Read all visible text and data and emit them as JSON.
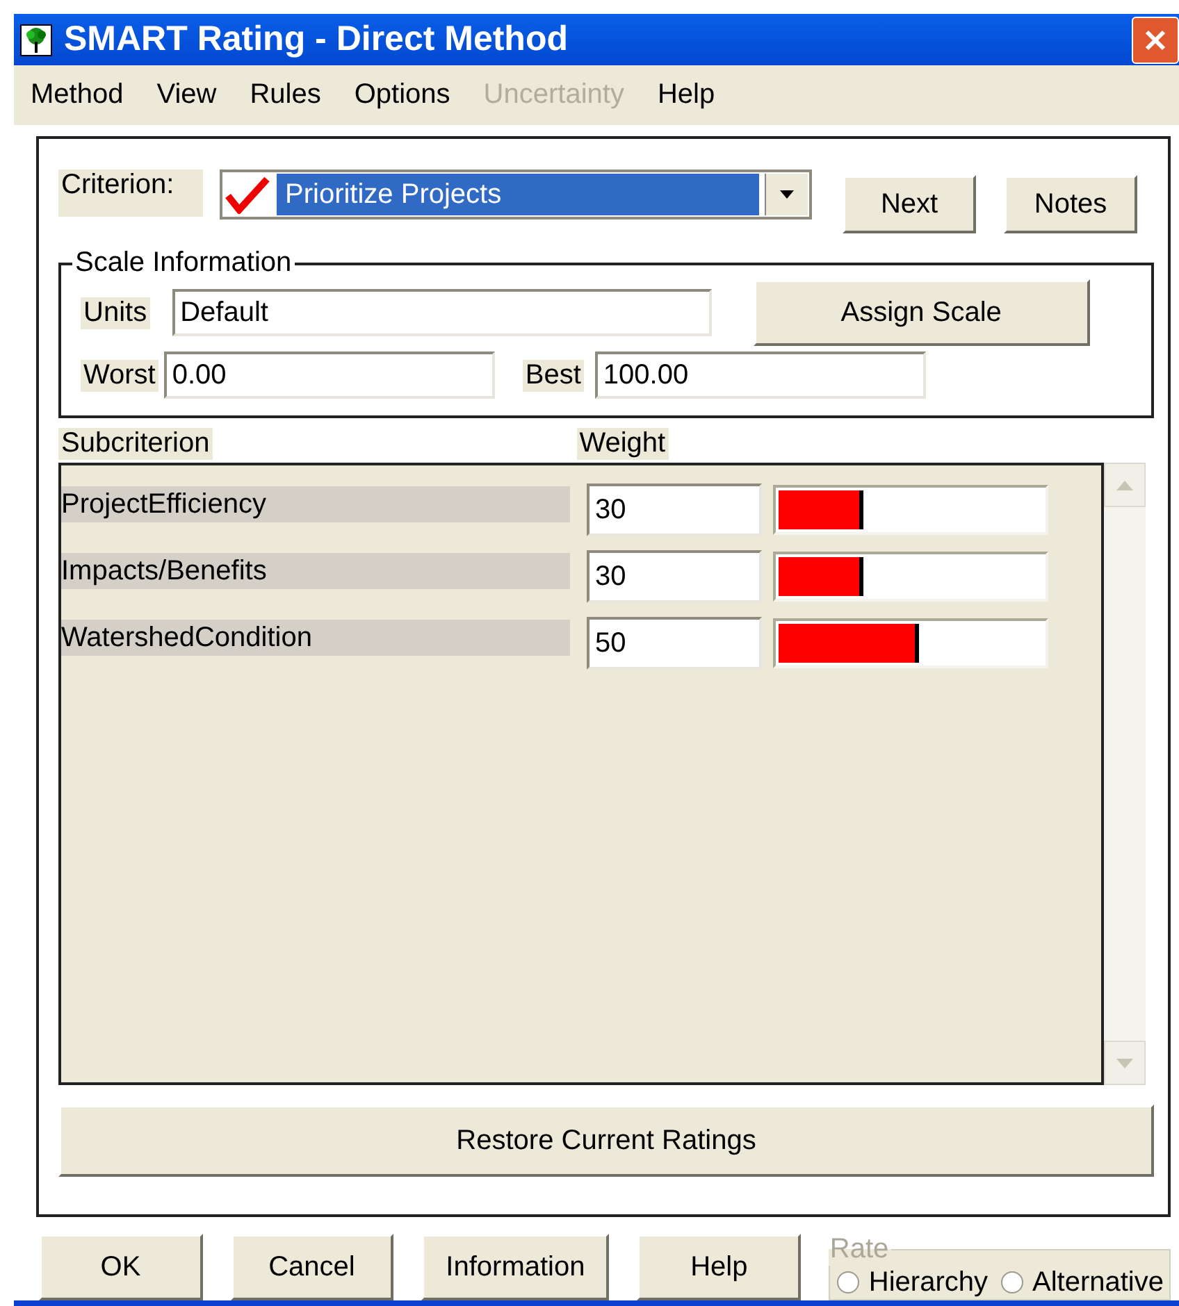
{
  "window": {
    "title": "SMART Rating - Direct Method"
  },
  "menu": [
    {
      "label": "Method",
      "disabled": false
    },
    {
      "label": "View",
      "disabled": false
    },
    {
      "label": "Rules",
      "disabled": false
    },
    {
      "label": "Options",
      "disabled": false
    },
    {
      "label": "Uncertainty",
      "disabled": true
    },
    {
      "label": "Help",
      "disabled": false
    }
  ],
  "criterion": {
    "label": "Criterion:",
    "value": "Prioritize Projects",
    "checked": true
  },
  "top_buttons": [
    "Next",
    "Notes"
  ],
  "scale_information": {
    "title": "Scale Information",
    "units_label": "Units",
    "units_value": "Default",
    "assign_button": "Assign Scale",
    "worst_label": "Worst",
    "worst_value": "0.00",
    "best_label": "Best",
    "best_value": "100.00"
  },
  "table": {
    "columns": [
      "Subcriterion",
      "Weight"
    ],
    "rows": [
      {
        "name": "ProjectEfficiency",
        "weight": "30",
        "level": 0.32
      },
      {
        "name": "Impacts/Benefits",
        "weight": "30",
        "level": 0.32
      },
      {
        "name": "WatershedCondition",
        "weight": "50",
        "level": 0.53
      }
    ]
  },
  "restore_button": "Restore Current Ratings",
  "bottom_buttons": [
    "OK",
    "Cancel",
    "Information",
    "Help"
  ],
  "rate": {
    "title": "Rate",
    "disabled": true,
    "options": [
      {
        "label": "Hierarchy",
        "selected": false
      },
      {
        "label": "Alternative",
        "selected": false
      }
    ]
  }
}
